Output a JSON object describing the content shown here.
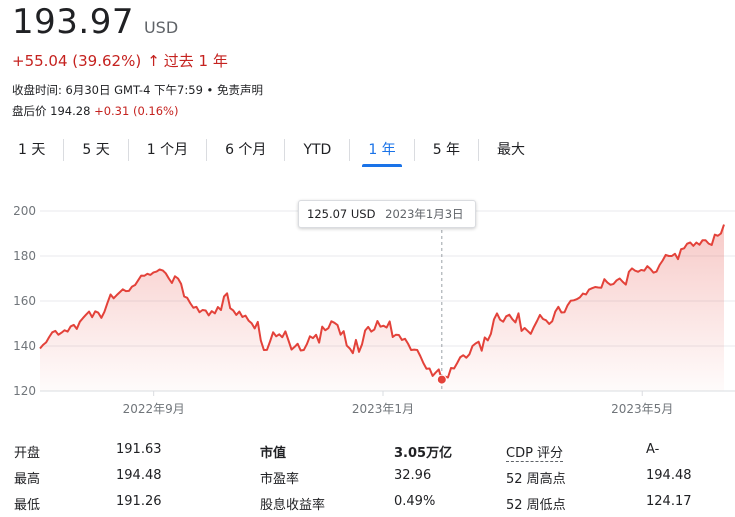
{
  "quote": {
    "price": "193.97",
    "currency": "USD",
    "change": "+55.04 (39.62%)",
    "change_arrow": "↑",
    "period": "过去 1 年",
    "close_time": "收盘时间: 6月30日 GMT-4 下午7:59 • 免责声明",
    "after_label": "盘后价",
    "after_price": "194.28",
    "after_change": "+0.31 (0.16%)"
  },
  "tabs": [
    {
      "label": "1 天",
      "active": false
    },
    {
      "label": "5 天",
      "active": false
    },
    {
      "label": "1 个月",
      "active": false
    },
    {
      "label": "6 个月",
      "active": false
    },
    {
      "label": "YTD",
      "active": false
    },
    {
      "label": "1 年",
      "active": true
    },
    {
      "label": "5 年",
      "active": false
    },
    {
      "label": "最大",
      "active": false
    }
  ],
  "tooltip": {
    "value": "125.07 USD",
    "date": "2023年1月3日"
  },
  "colors": {
    "line": "#e3423a",
    "accent": "#1a73e8",
    "negative": "#c5221f"
  },
  "chart_data": {
    "type": "area",
    "ylim": [
      120,
      200
    ],
    "y_ticks": [
      120,
      140,
      160,
      180,
      200
    ],
    "x_tick_labels": [
      "2022年9月",
      "2023年1月",
      "2023年5月"
    ],
    "grid": true,
    "series": [
      {
        "values": [
          138.9,
          140.5,
          141.6,
          144.0,
          146.1,
          146.7,
          145.0,
          145.9,
          147.0,
          146.4,
          148.7,
          149.4,
          147.6,
          150.8,
          152.4,
          153.9,
          155.3,
          152.8,
          155.4,
          154.8,
          152.5,
          155.2,
          159.2,
          162.9,
          161.2,
          162.6,
          163.9,
          165.2,
          164.4,
          164.5,
          166.4,
          167.1,
          169.2,
          171.3,
          171.2,
          172.1,
          171.6,
          172.7,
          173.1,
          174.0,
          173.6,
          172.3,
          170.0,
          168.0,
          171.0,
          170.0,
          167.6,
          162.0,
          161.4,
          159.0,
          157.0,
          157.4,
          155.0,
          156.0,
          155.8,
          153.6,
          155.5,
          154.5,
          157.3,
          156.0,
          162.0,
          163.4,
          156.8,
          155.8,
          153.8,
          155.3,
          152.9,
          153.5,
          151.3,
          150.1,
          147.8,
          150.7,
          142.4,
          138.2,
          138.3,
          142.0,
          146.1,
          144.3,
          145.2,
          143.9,
          146.5,
          142.5,
          138.4,
          139.6,
          141.0,
          138.0,
          138.2,
          140.8,
          144.3,
          143.5,
          145.0,
          141.5,
          148.6,
          147.0,
          147.9,
          151.0,
          150.3,
          149.3,
          145.0,
          146.6,
          140.2,
          138.9,
          136.8,
          142.7,
          137.4,
          140.8,
          146.9,
          148.5,
          146.4,
          147.3,
          151.1,
          148.6,
          149.0,
          148.2,
          150.9,
          144.0,
          145.0,
          144.9,
          142.7,
          143.2,
          141.0,
          138.2,
          138.4,
          138.2,
          135.5,
          132.4,
          129.9,
          130.0,
          126.7,
          128.2,
          129.6,
          125.1,
          126.4,
          126.0,
          130.2,
          130.0,
          132.4,
          135.0,
          135.9,
          134.8,
          136.3,
          140.0,
          141.1,
          141.9,
          137.9,
          143.8,
          142.5,
          145.4,
          151.8,
          154.5,
          151.7,
          150.8,
          153.2,
          153.9,
          151.9,
          150.5,
          154.5,
          146.7,
          148.0,
          146.7,
          145.4,
          148.4,
          151.0,
          153.8,
          152.0,
          151.4,
          149.8,
          151.0,
          155.3,
          157.4,
          154.9,
          155.0,
          158.1,
          160.1,
          160.3,
          160.8,
          161.6,
          163.3,
          162.9,
          165.1,
          165.7,
          166.2,
          166.0,
          165.9,
          169.7,
          168.2,
          167.2,
          167.6,
          169.2,
          170.0,
          168.5,
          167.3,
          173.0,
          174.5,
          173.5,
          173.0,
          173.8,
          173.5,
          175.5,
          174.3,
          172.6,
          173.1,
          176.0,
          178.0,
          180.5,
          180.0,
          180.0,
          181.0,
          178.6,
          183.0,
          183.4,
          185.5,
          186.0,
          184.5,
          186.0,
          185.0,
          187.0,
          187.0,
          185.5,
          184.9,
          189.5,
          189.0,
          190.0,
          193.97
        ],
        "marker_index": 131,
        "marker_value": 125.07
      }
    ]
  },
  "stats": {
    "col1": [
      {
        "label": "开盘",
        "value": "191.63"
      },
      {
        "label": "最高",
        "value": "194.48"
      },
      {
        "label": "最低",
        "value": "191.26"
      }
    ],
    "col2": [
      {
        "label": "市值",
        "value": "3.05万亿"
      },
      {
        "label": "市盈率",
        "value": "32.96"
      },
      {
        "label": "股息收益率",
        "value": "0.49%"
      }
    ],
    "col3": [
      {
        "label": "CDP 评分",
        "value": "A-"
      },
      {
        "label": "52 周高点",
        "value": "194.48"
      },
      {
        "label": "52 周低点",
        "value": "124.17"
      }
    ]
  }
}
